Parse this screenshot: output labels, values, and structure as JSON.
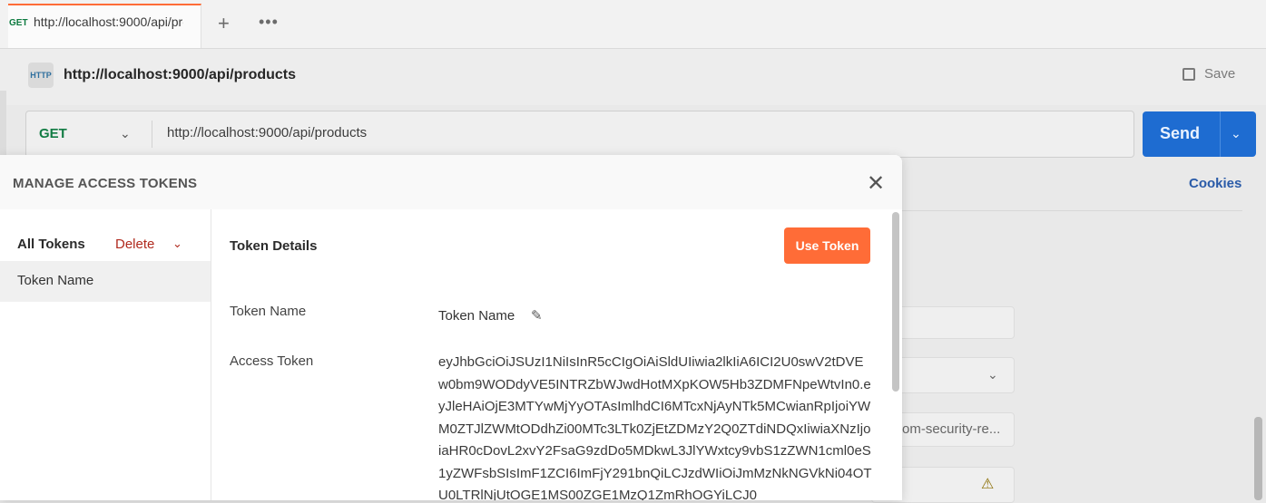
{
  "tabs": {
    "active": {
      "method": "GET",
      "url": "http://localhost:9000/api/products"
    },
    "new_tab_icon": "+",
    "more_icon": "•••"
  },
  "request": {
    "title": "http://localhost:9000/api/products",
    "save_label": "Save",
    "method": "GET",
    "url": "http://localhost:9000/api/products",
    "send_label": "Send",
    "cookies_label": "Cookies",
    "partial_field_text": "om-security-re..."
  },
  "modal": {
    "title": "MANAGE ACCESS TOKENS",
    "sidebar": {
      "all_tokens_label": "All Tokens",
      "delete_label": "Delete",
      "tokens": [
        {
          "name": "Token Name"
        }
      ]
    },
    "details": {
      "title": "Token Details",
      "use_token_label": "Use Token",
      "token_name_label": "Token Name",
      "token_name_value": "Token Name",
      "access_token_label": "Access Token",
      "access_token_value": "eyJhbGciOiJSUzI1NiIsInR5cCIgOiAiSldUIiwia2lkIiA6ICI2U0swV2tDVEw0bm9WODdyVE5INTRZbWJwdHotMXpKOW5Hb3ZDMFNpeWtvIn0.eyJleHAiOjE3MTYwMjYyOTAsImlhdCI6MTcxNjAyNTk5MCwianRpIjoiYWM0ZTJlZWMtODdhZi00MTc3LTk0ZjEtZDMzY2Q0ZTdiNDQxIiwiaXNzIjoiaHR0cDovL2xvY2FsaG9zdDo5MDkwL3JlYWxtcy9vbS1zZWN1cml0eS1yZWFsbSIsImF1ZCI6ImFjY291bnQiLCJzdWIiOiJmMzNkNGVkNi04OTU0LTRlNjUtOGE1MS00ZGE1MzQ1ZmRhOGYiLCJ0"
    }
  },
  "colors": {
    "accent": "#ff6c37",
    "send": "#1e6cd1",
    "delete": "#b02a1e",
    "get": "#127c44"
  }
}
